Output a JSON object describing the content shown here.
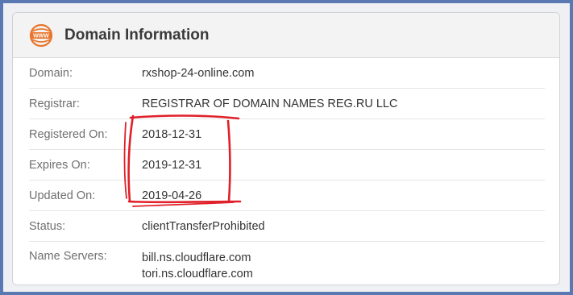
{
  "header": {
    "icon": "www-icon",
    "title": "Domain Information"
  },
  "rows": [
    {
      "label": "Domain:",
      "value": "rxshop-24-online.com"
    },
    {
      "label": "Registrar:",
      "value": "REGISTRAR OF DOMAIN NAMES REG.RU LLC"
    },
    {
      "label": "Registered On:",
      "value": "2018-12-31"
    },
    {
      "label": "Expires On:",
      "value": "2019-12-31"
    },
    {
      "label": "Updated On:",
      "value": "2019-04-26"
    },
    {
      "label": "Status:",
      "value": "clientTransferProhibited"
    }
  ],
  "name_servers": {
    "label": "Name Servers:",
    "values": [
      "bill.ns.cloudflare.com",
      "tori.ns.cloudflare.com"
    ]
  },
  "colors": {
    "icon": "#e8762c",
    "annotation": "#e0202a",
    "outer_border": "#5a78b2"
  }
}
